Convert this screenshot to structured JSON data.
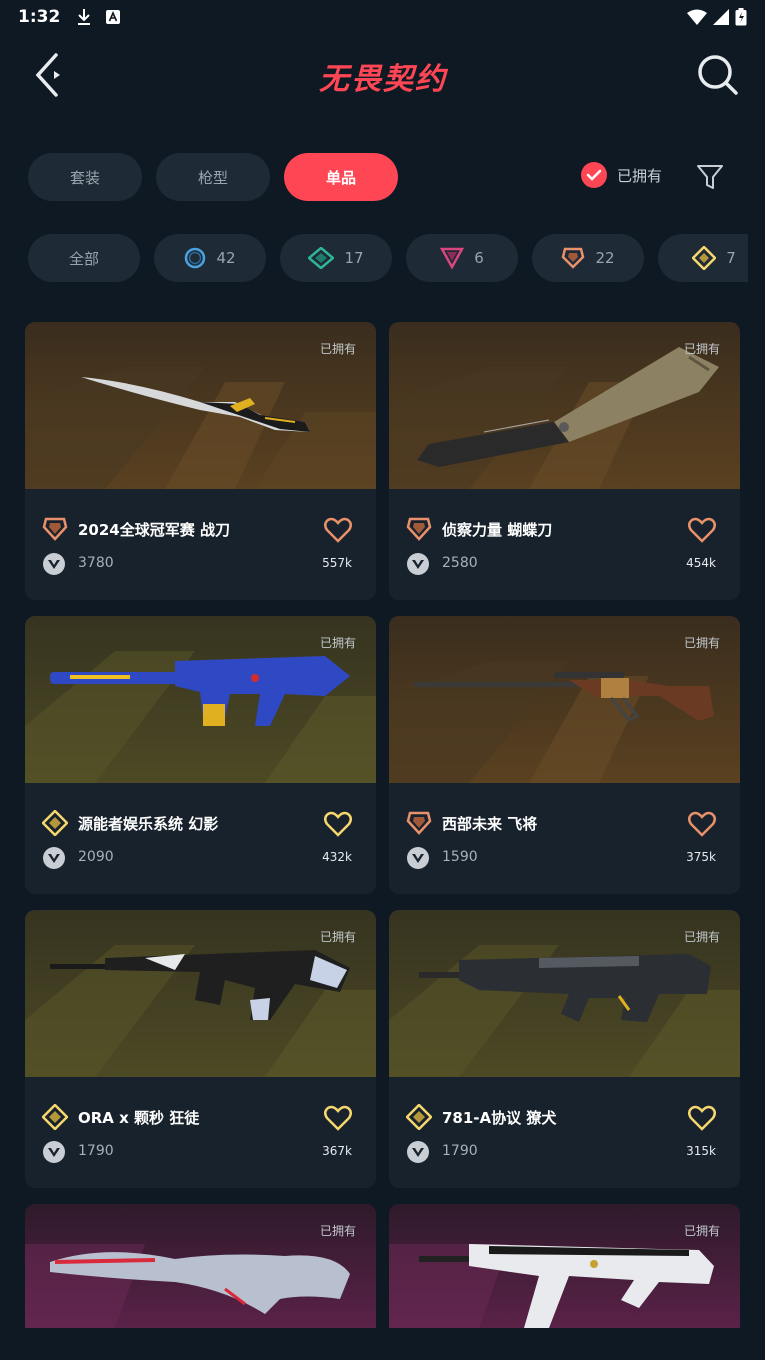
{
  "status_bar": {
    "time": "1:32"
  },
  "header": {
    "logo_text": "无畏契约"
  },
  "tabs": [
    {
      "label": "套装",
      "active": false
    },
    {
      "label": "枪型",
      "active": false
    },
    {
      "label": "单品",
      "active": true
    }
  ],
  "owned_filter": {
    "label": "已拥有",
    "checked": true
  },
  "chips": [
    {
      "label": "全部",
      "tier": ""
    },
    {
      "label": "42",
      "tier": "select"
    },
    {
      "label": "17",
      "tier": "deluxe"
    },
    {
      "label": "6",
      "tier": "premium"
    },
    {
      "label": "22",
      "tier": "exclusive"
    },
    {
      "label": "7",
      "tier": "ultra"
    }
  ],
  "colors": {
    "accent": "#ff4655",
    "background": "#0f1923",
    "card": "#18222c",
    "chip": "#1e2a35",
    "tier_exclusive": "#e8916a",
    "tier_ultra": "#f5d76e"
  },
  "cards": [
    {
      "owned_label": "已拥有",
      "name": "2024全球冠军赛 战刀",
      "price": "3780",
      "favs": "557k",
      "tier": "exclusive",
      "bg": "gold"
    },
    {
      "owned_label": "已拥有",
      "name": "侦察力量 蝴蝶刀",
      "price": "2580",
      "favs": "454k",
      "tier": "exclusive",
      "bg": "gold"
    },
    {
      "owned_label": "已拥有",
      "name": "源能者娱乐系统 幻影",
      "price": "2090",
      "favs": "432k",
      "tier": "ultra",
      "bg": "olive"
    },
    {
      "owned_label": "已拥有",
      "name": "西部未来 飞将",
      "price": "1590",
      "favs": "375k",
      "tier": "exclusive",
      "bg": "gold"
    },
    {
      "owned_label": "已拥有",
      "name": "ORA x 颗秒 狂徒",
      "price": "1790",
      "favs": "367k",
      "tier": "ultra",
      "bg": "olive"
    },
    {
      "owned_label": "已拥有",
      "name": "781-A协议 獠犬",
      "price": "1790",
      "favs": "315k",
      "tier": "ultra",
      "bg": "olive"
    },
    {
      "owned_label": "已拥有",
      "name": "",
      "price": "",
      "favs": "",
      "tier": "",
      "bg": "purple"
    },
    {
      "owned_label": "已拥有",
      "name": "",
      "price": "",
      "favs": "",
      "tier": "",
      "bg": "purple"
    }
  ]
}
